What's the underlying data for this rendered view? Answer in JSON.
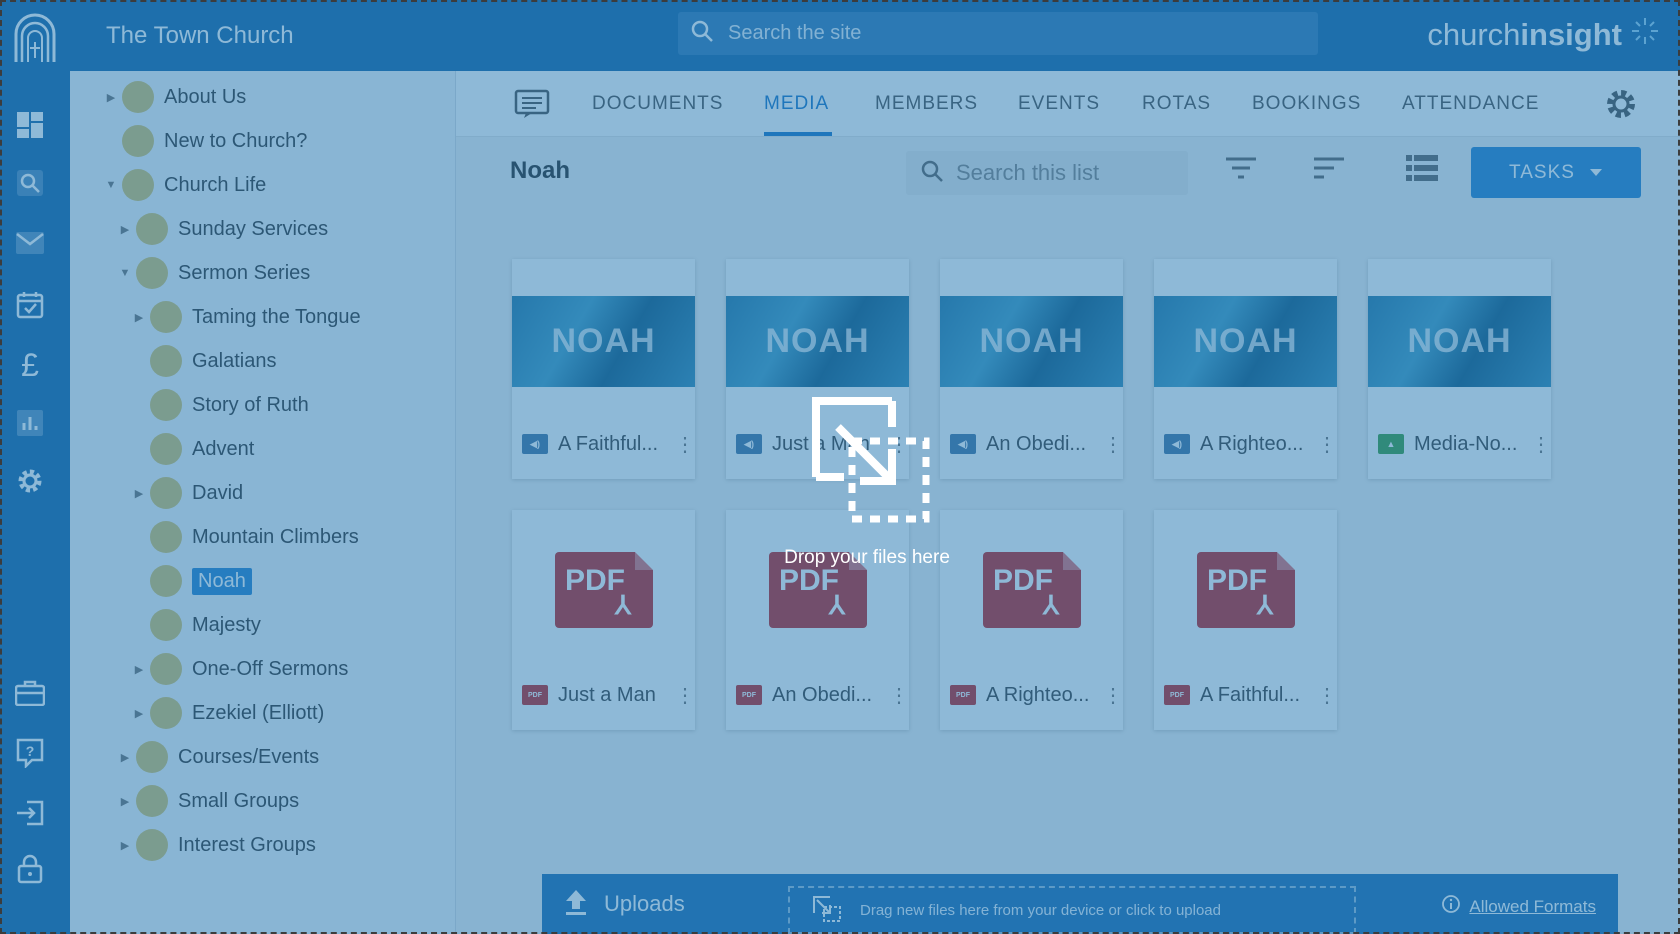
{
  "header": {
    "site_title": "The Town Church",
    "search_placeholder": "Search the site",
    "brand_light": "church",
    "brand_bold": "insight"
  },
  "rail_icons": [
    "dashboard-icon",
    "search-icon",
    "mail-icon",
    "calendar-icon",
    "pound-icon",
    "chart-icon",
    "gear-icon",
    "briefcase-icon",
    "help-icon",
    "sign-in-icon",
    "lock-icon"
  ],
  "tree": {
    "items": [
      {
        "label": "About Us",
        "expander": "collapsed"
      },
      {
        "label": "New to Church?",
        "expander": "none"
      },
      {
        "label": "Church Life",
        "expander": "expanded"
      },
      {
        "label": "Sunday Services",
        "expander": "collapsed"
      },
      {
        "label": "Sermon Series",
        "expander": "expanded"
      },
      {
        "label": "Taming the Tongue",
        "expander": "collapsed"
      },
      {
        "label": "Galatians",
        "expander": "none"
      },
      {
        "label": "Story of Ruth",
        "expander": "none"
      },
      {
        "label": "Advent",
        "expander": "none"
      },
      {
        "label": "David",
        "expander": "collapsed"
      },
      {
        "label": "Mountain Climbers",
        "expander": "none"
      },
      {
        "label": "Noah",
        "expander": "none",
        "selected": true
      },
      {
        "label": "Majesty",
        "expander": "none"
      },
      {
        "label": "One-Off Sermons",
        "expander": "collapsed"
      },
      {
        "label": "Ezekiel (Elliott)",
        "expander": "collapsed"
      },
      {
        "label": "Courses/Events",
        "expander": "collapsed"
      },
      {
        "label": "Small Groups",
        "expander": "collapsed"
      },
      {
        "label": "Interest Groups",
        "expander": "collapsed"
      }
    ]
  },
  "tabs": [
    "DOCUMENTS",
    "MEDIA",
    "MEMBERS",
    "EVENTS",
    "ROTAS",
    "BOOKINGS",
    "ATTENDANCE"
  ],
  "active_tab": "MEDIA",
  "list": {
    "title": "Noah",
    "search_placeholder": "Search this list",
    "tasks_label": "TASKS"
  },
  "media": [
    {
      "kind": "thumb",
      "thumb_text": "NOAH",
      "type": "audio",
      "name": "A Faithful..."
    },
    {
      "kind": "thumb",
      "thumb_text": "NOAH",
      "type": "audio",
      "name": "Just a Man"
    },
    {
      "kind": "thumb",
      "thumb_text": "NOAH",
      "type": "audio",
      "name": "An Obedi..."
    },
    {
      "kind": "thumb",
      "thumb_text": "NOAH",
      "type": "audio",
      "name": "A Righteo..."
    },
    {
      "kind": "thumb",
      "thumb_text": "NOAH",
      "type": "image",
      "name": "Media-No..."
    },
    {
      "kind": "pdf",
      "thumb_text": "PDF",
      "type": "pdf",
      "name": "Just a Man"
    },
    {
      "kind": "pdf",
      "thumb_text": "PDF",
      "type": "pdf",
      "name": "An Obedi..."
    },
    {
      "kind": "pdf",
      "thumb_text": "PDF",
      "type": "pdf",
      "name": "A Righteo..."
    },
    {
      "kind": "pdf",
      "thumb_text": "PDF",
      "type": "pdf",
      "name": "A Faithful..."
    }
  ],
  "uploads": {
    "label": "Uploads",
    "hint": "Drag new files here from your device or click to upload",
    "formats_label": "Allowed Formats"
  },
  "overlay": {
    "message": "Drop your files here"
  },
  "colors": {
    "primary": "#1f6aa8",
    "accent": "#2f86d0",
    "overlay": "#1e73af",
    "folder_dot": "#d9c46f",
    "pdf": "#c62828"
  }
}
